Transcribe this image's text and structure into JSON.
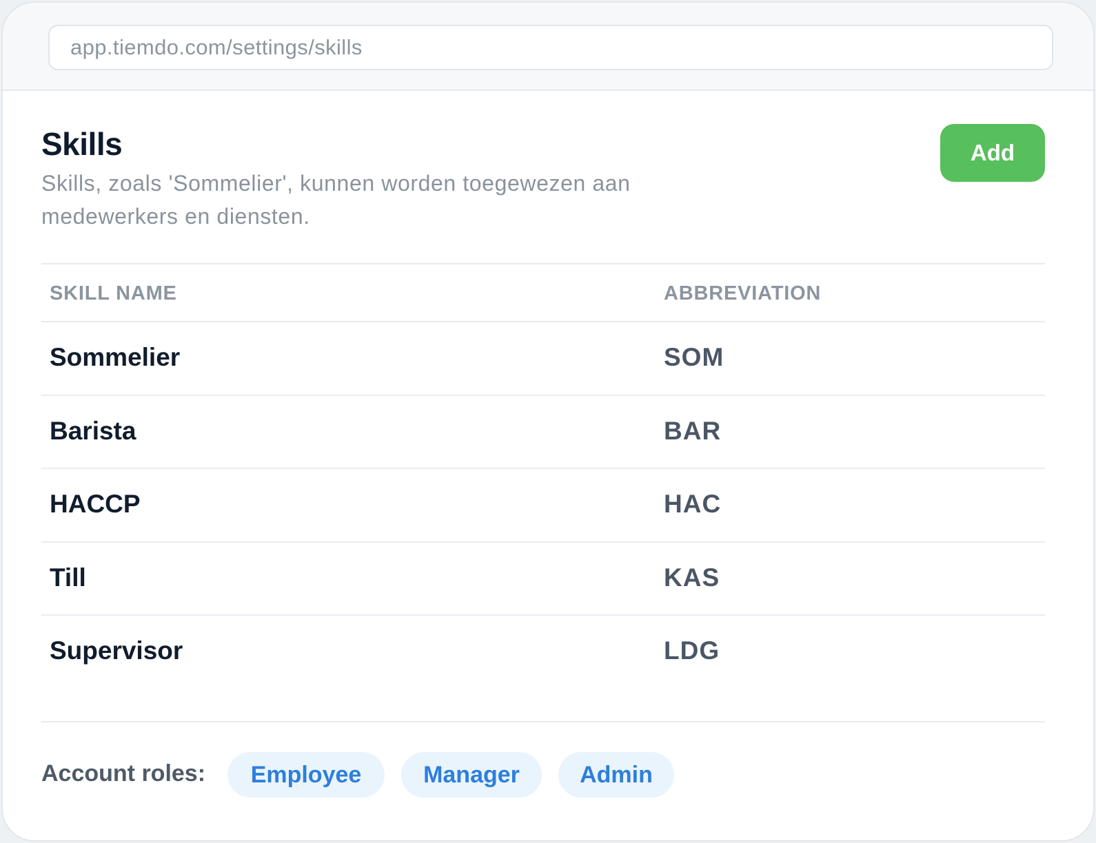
{
  "browser": {
    "url": "app.tiemdo.com/settings/skills"
  },
  "header": {
    "title": "Skills",
    "description": "Skills, zoals 'Sommelier', kunnen worden toegewezen aan medewerkers en diensten.",
    "add_label": "Add"
  },
  "table": {
    "columns": {
      "name": "SKILL NAME",
      "abbreviation": "ABBREVIATION"
    },
    "rows": [
      {
        "name": "Sommelier",
        "abbreviation": "SOM"
      },
      {
        "name": "Barista",
        "abbreviation": "BAR"
      },
      {
        "name": "HACCP",
        "abbreviation": "HAC"
      },
      {
        "name": "Till",
        "abbreviation": "KAS"
      },
      {
        "name": "Supervisor",
        "abbreviation": "LDG"
      }
    ]
  },
  "footer": {
    "roles_label": "Account roles:",
    "roles": [
      "Employee",
      "Manager",
      "Admin"
    ]
  },
  "colors": {
    "accent_green": "#57bf5c",
    "role_chip_text": "#2d7fdc",
    "role_chip_bg": "#eaf4fd"
  }
}
